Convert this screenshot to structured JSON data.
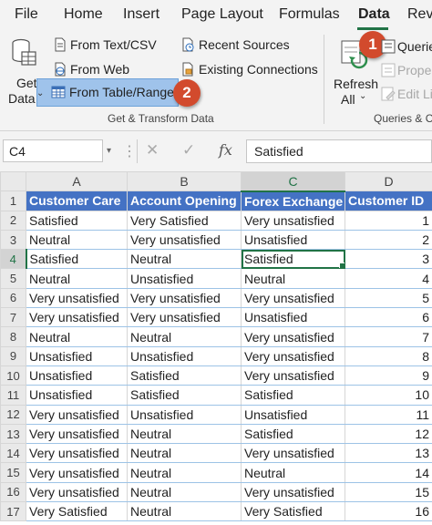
{
  "menu": {
    "items": [
      "File",
      "Home",
      "Insert",
      "Page Layout",
      "Formulas",
      "Data",
      "Rev"
    ],
    "active": "Data"
  },
  "ribbon": {
    "get_data": {
      "line1": "Get",
      "line2": "Data"
    },
    "from_text_csv": "From Text/CSV",
    "from_web": "From Web",
    "from_table_range": "From Table/Range",
    "recent_sources": "Recent Sources",
    "existing_connections": "Existing Connections",
    "group_get_transform": "Get & Transform Data",
    "refresh_all": {
      "line1": "Refresh",
      "line2": "All"
    },
    "queries": "Querie",
    "properties": "Proper",
    "edit_links": "Edit Li",
    "group_queries": "Queries & C",
    "badge_1": "1",
    "badge_2": "2",
    "highlight_color": "#9fc3eb",
    "badge_color": "#d24a2d"
  },
  "formula_bar": {
    "name_box": "C4",
    "fx": "fx",
    "value": "Satisfied"
  },
  "sheet": {
    "columns": [
      "A",
      "B",
      "C",
      "D"
    ],
    "selected_column": "C",
    "selected_row": "4",
    "header_color": "#4472c4",
    "headers": [
      "Customer Care",
      "Account Opening",
      "Forex Exchange",
      "Customer ID"
    ],
    "rows": [
      {
        "n": "2",
        "cells": [
          "Satisfied",
          "Very Satisfied",
          "Very unsatisfied",
          "1"
        ]
      },
      {
        "n": "3",
        "cells": [
          "Neutral",
          "Very unsatisfied",
          "Unsatisfied",
          "2"
        ]
      },
      {
        "n": "4",
        "cells": [
          "Satisfied",
          "Neutral",
          "Satisfied",
          "3"
        ]
      },
      {
        "n": "5",
        "cells": [
          "Neutral",
          "Unsatisfied",
          "Neutral",
          "4"
        ]
      },
      {
        "n": "6",
        "cells": [
          "Very unsatisfied",
          "Very unsatisfied",
          "Very unsatisfied",
          "5"
        ]
      },
      {
        "n": "7",
        "cells": [
          "Very unsatisfied",
          "Very unsatisfied",
          "Unsatisfied",
          "6"
        ]
      },
      {
        "n": "8",
        "cells": [
          "Neutral",
          "Neutral",
          "Very unsatisfied",
          "7"
        ]
      },
      {
        "n": "9",
        "cells": [
          "Unsatisfied",
          "Unsatisfied",
          "Very unsatisfied",
          "8"
        ]
      },
      {
        "n": "10",
        "cells": [
          "Unsatisfied",
          "Satisfied",
          "Very unsatisfied",
          "9"
        ]
      },
      {
        "n": "11",
        "cells": [
          "Unsatisfied",
          "Satisfied",
          "Satisfied",
          "10"
        ]
      },
      {
        "n": "12",
        "cells": [
          "Very unsatisfied",
          "Unsatisfied",
          "Unsatisfied",
          "11"
        ]
      },
      {
        "n": "13",
        "cells": [
          "Very unsatisfied",
          "Neutral",
          "Satisfied",
          "12"
        ]
      },
      {
        "n": "14",
        "cells": [
          "Very unsatisfied",
          "Neutral",
          "Very unsatisfied",
          "13"
        ]
      },
      {
        "n": "15",
        "cells": [
          "Very unsatisfied",
          "Neutral",
          "Neutral",
          "14"
        ]
      },
      {
        "n": "16",
        "cells": [
          "Very unsatisfied",
          "Neutral",
          "Very unsatisfied",
          "15"
        ]
      },
      {
        "n": "17",
        "cells": [
          "Very Satisfied",
          "Neutral",
          "Very Satisfied",
          "16"
        ]
      }
    ]
  }
}
